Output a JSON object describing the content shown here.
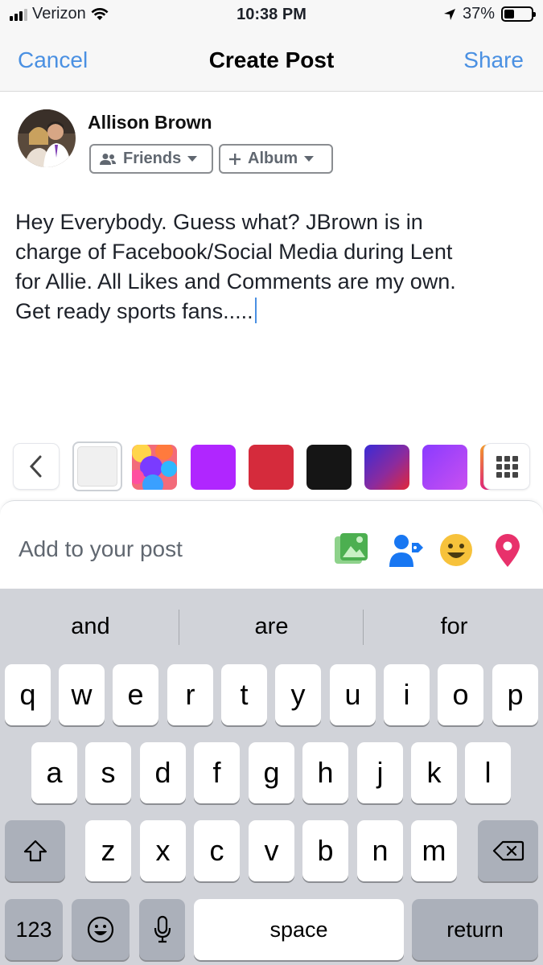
{
  "status": {
    "carrier": "Verizon",
    "time": "10:38 PM",
    "battery": "37%",
    "battery_level": 0.37
  },
  "nav": {
    "cancel": "Cancel",
    "title": "Create Post",
    "share": "Share"
  },
  "author": {
    "name": "Allison Brown",
    "audience": "Friends",
    "album": "Album"
  },
  "post": {
    "lines": [
      "Hey Everybody.  Guess what?  JBrown is in",
      "charge of Facebook/Social Media during Lent",
      "for Allie. All Likes and Comments are my own.",
      "Get ready sports fans....."
    ]
  },
  "backgrounds": {
    "colors": [
      "#b026ff",
      "#d52b3c",
      "#151515"
    ]
  },
  "add_to_post": {
    "label": "Add to your post",
    "icons": [
      "photo-icon",
      "tag-people-icon",
      "feeling-icon",
      "location-icon"
    ]
  },
  "keyboard": {
    "suggestions": [
      "and",
      "are",
      "for"
    ],
    "row1": [
      "q",
      "w",
      "e",
      "r",
      "t",
      "y",
      "u",
      "i",
      "o",
      "p"
    ],
    "row2": [
      "a",
      "s",
      "d",
      "f",
      "g",
      "h",
      "j",
      "k",
      "l"
    ],
    "row3": [
      "z",
      "x",
      "c",
      "v",
      "b",
      "n",
      "m"
    ],
    "numbers": "123",
    "space": "space",
    "return": "return"
  }
}
